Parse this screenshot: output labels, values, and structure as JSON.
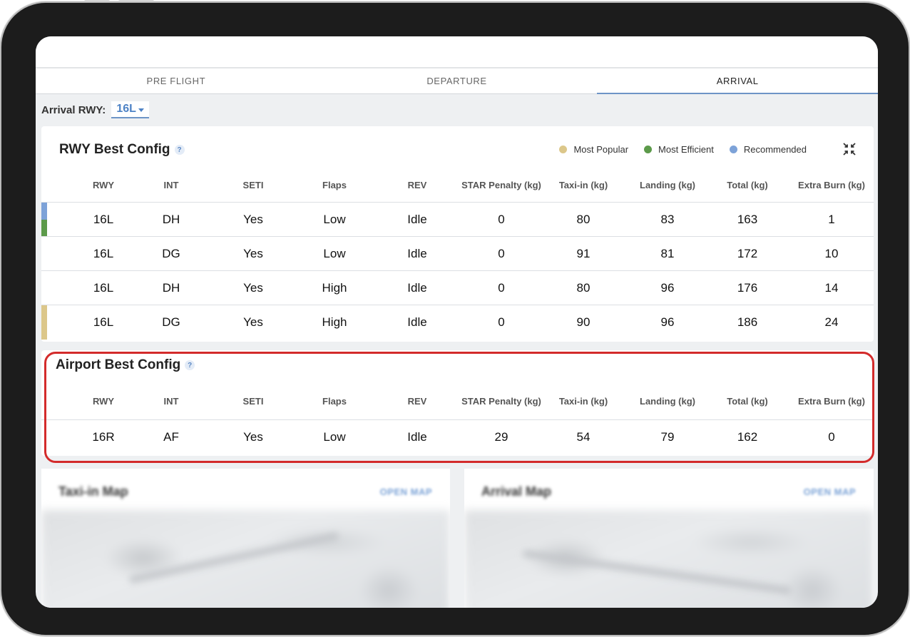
{
  "tabs": [
    {
      "label": "PRE FLIGHT",
      "active": false
    },
    {
      "label": "DEPARTURE",
      "active": false
    },
    {
      "label": "ARRIVAL",
      "active": true
    }
  ],
  "arrival_rwy": {
    "label": "Arrival RWY:",
    "value": "16L"
  },
  "columns": [
    "RWY",
    "INT",
    "SETI",
    "Flaps",
    "REV",
    "STAR Penalty (kg)",
    "Taxi-in (kg)",
    "Landing (kg)",
    "Total (kg)",
    "Extra Burn (kg)"
  ],
  "rwy_best_config": {
    "title": "RWY Best Config",
    "help": "?",
    "legend": [
      {
        "label": "Most Popular",
        "color": "#dcc78a"
      },
      {
        "label": "Most Efficient",
        "color": "#5c9a4a"
      },
      {
        "label": "Recommended",
        "color": "#7da2d8"
      }
    ],
    "rows": [
      {
        "cells": [
          "16L",
          "DH",
          "Yes",
          "Low",
          "Idle",
          "0",
          "80",
          "83",
          "163",
          "1"
        ],
        "markers": [
          "#7da2d8",
          "#5c9a4a"
        ]
      },
      {
        "cells": [
          "16L",
          "DG",
          "Yes",
          "Low",
          "Idle",
          "0",
          "91",
          "81",
          "172",
          "10"
        ],
        "markers": []
      },
      {
        "cells": [
          "16L",
          "DH",
          "Yes",
          "High",
          "Idle",
          "0",
          "80",
          "96",
          "176",
          "14"
        ],
        "markers": []
      },
      {
        "cells": [
          "16L",
          "DG",
          "Yes",
          "High",
          "Idle",
          "0",
          "90",
          "96",
          "186",
          "24"
        ],
        "markers": [
          "#dcc78a"
        ]
      }
    ]
  },
  "airport_best_config": {
    "title": "Airport Best Config",
    "help": "?",
    "rows": [
      {
        "cells": [
          "16R",
          "AF",
          "Yes",
          "Low",
          "Idle",
          "29",
          "54",
          "79",
          "162",
          "0"
        ]
      }
    ]
  },
  "maps": [
    {
      "title": "Taxi-in Map",
      "link": "OPEN MAP"
    },
    {
      "title": "Arrival Map",
      "link": "OPEN MAP"
    }
  ],
  "highlight_color": "#d32b2b",
  "accent_color": "#4d82c5"
}
